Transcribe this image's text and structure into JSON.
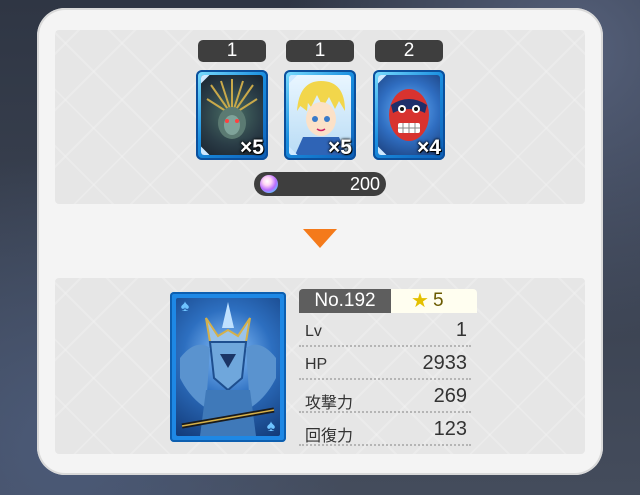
{
  "materials": [
    {
      "count": "1",
      "qty": "×5",
      "name": "crown-dragon-card"
    },
    {
      "count": "1",
      "qty": "×5",
      "name": "blonde-hero-card"
    },
    {
      "count": "2",
      "qty": "×4",
      "name": "red-mask-card"
    }
  ],
  "cost": {
    "icon": "fusion-orb-icon",
    "value": "200"
  },
  "result": {
    "no_label": "No.192",
    "rarity": "5",
    "stats": [
      {
        "label": "Lv",
        "value": "1"
      },
      {
        "label": "HP",
        "value": "2933"
      },
      {
        "label": "攻撃力",
        "value": "269"
      },
      {
        "label": "回復力",
        "value": "123"
      }
    ]
  },
  "colors": {
    "accent_arrow": "#f47a1a",
    "card_frame": "#1e88e5",
    "pill_bg": "#3e3e3e"
  }
}
